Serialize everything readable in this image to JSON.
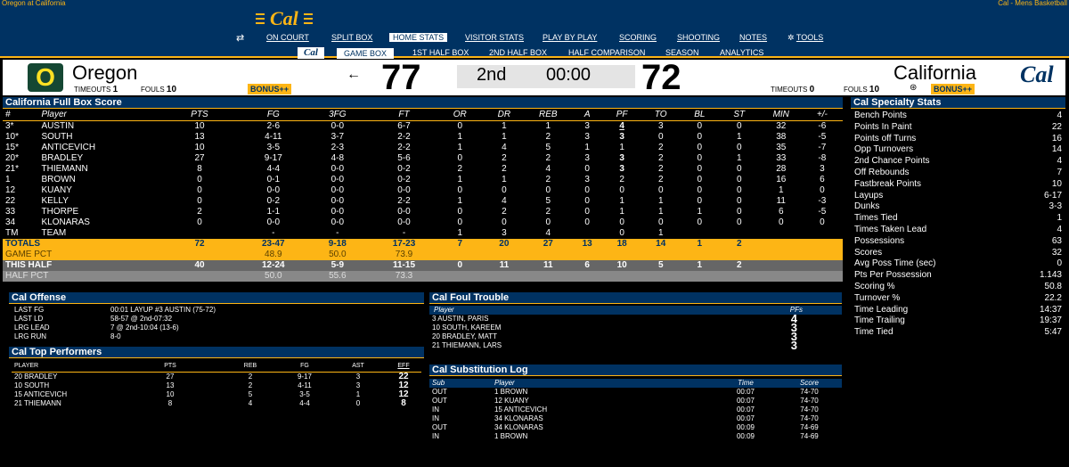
{
  "window": {
    "title_left": "Oregon at California",
    "title_right": "Cal - Mens Basketball"
  },
  "brand": {
    "logo": "Cal",
    "small_logo": "Cal"
  },
  "nav1": [
    "ON COURT",
    "SPLIT BOX",
    "HOME STATS",
    "VISITOR STATS",
    "PLAY BY PLAY",
    "SCORING",
    "SHOOTING",
    "NOTES",
    "TOOLS"
  ],
  "nav2": [
    "GAME BOX",
    "1ST HALF BOX",
    "2ND HALF BOX",
    "HALF COMPARISON",
    "SEASON",
    "ANALYTICS"
  ],
  "scoreboard": {
    "visitor": {
      "logo": "O",
      "name": "Oregon",
      "timeouts_label": "TIMEOUTS",
      "timeouts": "1",
      "fouls_label": "FOULS",
      "fouls": "10",
      "bonus": "BONUS++",
      "score": "77",
      "arrow": "←"
    },
    "home": {
      "name": "California",
      "timeouts_label": "TIMEOUTS",
      "timeouts": "0",
      "fouls_label": "FOULS",
      "fouls": "10",
      "bonus": "BONUS++",
      "score": "72",
      "logo": "Cal"
    },
    "period": "2nd",
    "clock": "00:00"
  },
  "box": {
    "title": "California Full Box Score",
    "headers": [
      "#",
      "Player",
      "PTS",
      "FG",
      "3FG",
      "FT",
      "OR",
      "DR",
      "REB",
      "A",
      "PF",
      "TO",
      "BL",
      "ST",
      "MIN",
      "+/-"
    ],
    "rows": [
      [
        "3*",
        "AUSTIN",
        "10",
        "2-6",
        "0-0",
        "6-7",
        "0",
        "1",
        "1",
        "3",
        "4",
        "3",
        "0",
        "0",
        "32",
        "-6"
      ],
      [
        "10*",
        "SOUTH",
        "13",
        "4-11",
        "3-7",
        "2-2",
        "1",
        "1",
        "2",
        "3",
        "3",
        "0",
        "0",
        "1",
        "38",
        "-5"
      ],
      [
        "15*",
        "ANTICEVICH",
        "10",
        "3-5",
        "2-3",
        "2-2",
        "1",
        "4",
        "5",
        "1",
        "1",
        "2",
        "0",
        "0",
        "35",
        "-7"
      ],
      [
        "20*",
        "BRADLEY",
        "27",
        "9-17",
        "4-8",
        "5-6",
        "0",
        "2",
        "2",
        "3",
        "3",
        "2",
        "0",
        "1",
        "33",
        "-8"
      ],
      [
        "21*",
        "THIEMANN",
        "8",
        "4-4",
        "0-0",
        "0-2",
        "2",
        "2",
        "4",
        "0",
        "3",
        "2",
        "0",
        "0",
        "28",
        "3"
      ],
      [
        "1",
        "BROWN",
        "0",
        "0-1",
        "0-0",
        "0-2",
        "1",
        "1",
        "2",
        "3",
        "2",
        "2",
        "0",
        "0",
        "16",
        "6"
      ],
      [
        "12",
        "KUANY",
        "0",
        "0-0",
        "0-0",
        "0-0",
        "0",
        "0",
        "0",
        "0",
        "0",
        "0",
        "0",
        "0",
        "1",
        "0"
      ],
      [
        "22",
        "KELLY",
        "0",
        "0-2",
        "0-0",
        "2-2",
        "1",
        "4",
        "5",
        "0",
        "1",
        "1",
        "0",
        "0",
        "11",
        "-3"
      ],
      [
        "33",
        "THORPE",
        "2",
        "1-1",
        "0-0",
        "0-0",
        "0",
        "2",
        "2",
        "0",
        "1",
        "1",
        "1",
        "0",
        "6",
        "-5"
      ],
      [
        "34",
        "KLONARAS",
        "0",
        "0-0",
        "0-0",
        "0-0",
        "0",
        "0",
        "0",
        "0",
        "0",
        "0",
        "0",
        "0",
        "0",
        "0"
      ],
      [
        "TM",
        "TEAM",
        "",
        "-",
        "-",
        "-",
        "1",
        "3",
        "4",
        "",
        "0",
        "1",
        "",
        "",
        "",
        ""
      ]
    ],
    "totals": {
      "label": "TOTALS",
      "pts": "72",
      "fg": "23-47",
      "tfg": "9-18",
      "ft": "17-23",
      "or": "7",
      "dr": "20",
      "reb": "27",
      "a": "13",
      "pf": "18",
      "to": "14",
      "bl": "1",
      "st": "2"
    },
    "game_pct": {
      "label": "GAME PCT",
      "fg": "48.9",
      "tfg": "50.0",
      "ft": "73.9"
    },
    "this_half": {
      "label": "THIS HALF",
      "pts": "40",
      "fg": "12-24",
      "tfg": "5-9",
      "ft": "11-15",
      "or": "0",
      "dr": "11",
      "reb": "11",
      "a": "6",
      "pf": "10",
      "to": "5",
      "bl": "1",
      "st": "2"
    },
    "half_pct": {
      "label": "HALF PCT",
      "fg": "50.0",
      "tfg": "55.6",
      "ft": "73.3"
    }
  },
  "specialty": {
    "title": "Cal Specialty Stats",
    "rows": [
      [
        "Bench Points",
        "4"
      ],
      [
        "Points In Paint",
        "22"
      ],
      [
        "Points off Turns",
        "16"
      ],
      [
        "Opp Turnovers",
        "14"
      ],
      [
        "2nd Chance Points",
        "4"
      ],
      [
        "Off Rebounds",
        "7"
      ],
      [
        "Fastbreak Points",
        "10"
      ],
      [
        "Layups",
        "6-17"
      ],
      [
        "Dunks",
        "3-3"
      ],
      [
        "Times Tied",
        "1"
      ],
      [
        "Times Taken Lead",
        "4"
      ],
      [
        "Possessions",
        "63"
      ],
      [
        "Scores",
        "32"
      ],
      [
        "Avg Poss Time (sec)",
        "0"
      ],
      [
        "Pts Per Possession",
        "1.143"
      ],
      [
        "Scoring %",
        "50.8"
      ],
      [
        "Turnover %",
        "22.2"
      ],
      [
        "Time Leading",
        "14:37"
      ],
      [
        "Time Trailing",
        "19:37"
      ],
      [
        "Time Tied",
        "5:47"
      ]
    ]
  },
  "offense": {
    "title": "Cal Offense",
    "rows": [
      [
        "LAST FG",
        "00:01 LAYUP #3 AUSTIN (75-72)"
      ],
      [
        "LAST LD",
        "58-57 @ 2nd-07:32"
      ],
      [
        "LRG LEAD",
        "7 @ 2nd-10:04 (13-6)"
      ],
      [
        "LRG RUN",
        "8-0"
      ]
    ]
  },
  "performers": {
    "title": "Cal Top Performers",
    "headers": [
      "PLAYER",
      "PTS",
      "REB",
      "FG",
      "AST",
      "EFF"
    ],
    "rows": [
      [
        "20 BRADLEY",
        "27",
        "2",
        "9-17",
        "3",
        "22"
      ],
      [
        "10 SOUTH",
        "13",
        "2",
        "4-11",
        "3",
        "12"
      ],
      [
        "15 ANTICEVICH",
        "10",
        "5",
        "3-5",
        "1",
        "12"
      ],
      [
        "21 THIEMANN",
        "8",
        "4",
        "4-4",
        "0",
        "8"
      ]
    ]
  },
  "fouls": {
    "title": "Cal Foul Trouble",
    "headers": [
      "Player",
      "PFs"
    ],
    "rows": [
      [
        "3 AUSTIN, PARIS",
        "4"
      ],
      [
        "10 SOUTH, KAREEM",
        "3"
      ],
      [
        "20 BRADLEY, MATT",
        "3"
      ],
      [
        "21 THIEMANN, LARS",
        "3"
      ]
    ]
  },
  "subs": {
    "title": "Cal Substitution Log",
    "headers": [
      "Sub",
      "Player",
      "Time",
      "Score"
    ],
    "rows": [
      [
        "OUT",
        "1 BROWN",
        "00:07",
        "74-70"
      ],
      [
        "OUT",
        "12 KUANY",
        "00:07",
        "74-70"
      ],
      [
        "IN",
        "15 ANTICEVICH",
        "00:07",
        "74-70"
      ],
      [
        "IN",
        "34 KLONARAS",
        "00:07",
        "74-70"
      ],
      [
        "OUT",
        "34 KLONARAS",
        "00:09",
        "74-69"
      ],
      [
        "IN",
        "1 BROWN",
        "00:09",
        "74-69"
      ]
    ]
  }
}
